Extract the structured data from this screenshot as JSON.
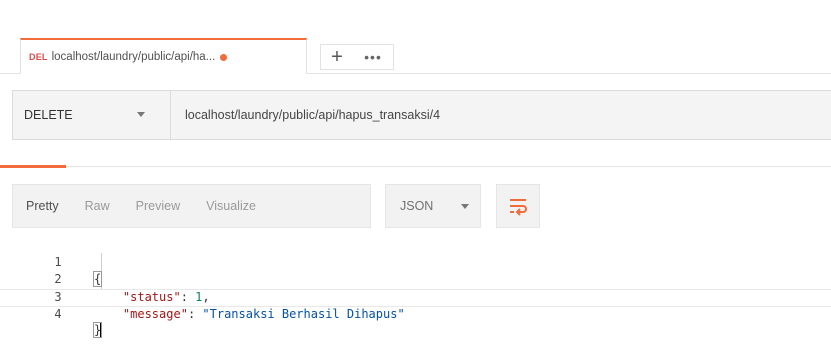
{
  "tabs": {
    "active": {
      "method_badge": "DEL",
      "title": "localhost/laundry/public/api/ha..."
    },
    "add_label": "+",
    "more_label": "•••"
  },
  "request": {
    "method": "DELETE",
    "url": "localhost/laundry/public/api/hapus_transaksi/4"
  },
  "response": {
    "view_options": [
      "Pretty",
      "Raw",
      "Preview",
      "Visualize"
    ],
    "active_view": "Pretty",
    "format": "JSON",
    "lines": {
      "l1": "{",
      "l2_key": "\"status\"",
      "l2_val": "1",
      "l3_key": "\"message\"",
      "l3_val": "\"Transaksi Berhasil Dihapus\"",
      "l4": "}"
    },
    "line_numbers": [
      "1",
      "2",
      "3",
      "4"
    ]
  },
  "colors": {
    "accent": "#f26b3a",
    "method_delete": "#e04b4b",
    "json_key": "#a31515",
    "json_string": "#0451a5",
    "json_number": "#098658"
  },
  "icons": {
    "unsaved_indicator": "dot-icon",
    "method_dropdown": "chevron-down-icon",
    "format_dropdown": "chevron-down-icon",
    "wrap": "wrap-lines-icon"
  }
}
